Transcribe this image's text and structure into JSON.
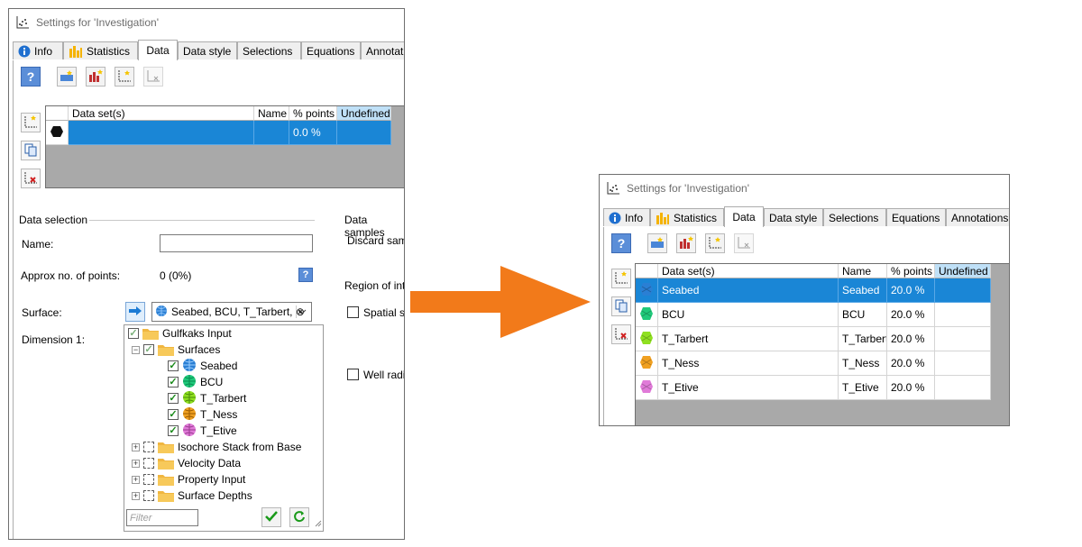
{
  "dialog_title": "Settings for 'Investigation'",
  "tabs_left": [
    "Info",
    "Statistics",
    "Data",
    "Data style",
    "Selections",
    "Equations",
    "Annotatio"
  ],
  "tabs_right": [
    "Info",
    "Statistics",
    "Data",
    "Data style",
    "Selections",
    "Equations",
    "Annotations"
  ],
  "grid_headers": {
    "dataset": "Data set(s)",
    "name": "Name",
    "points": "% points",
    "undefined": "Undefined"
  },
  "left_grid_rows": [
    {
      "dataset": "",
      "name": "",
      "points": "0.0 %",
      "undefined": ""
    }
  ],
  "right_grid_rows": [
    {
      "dataset": "Seabed",
      "name": "Seabed",
      "points": "20.0 %",
      "undefined": "",
      "icon_color": "#2a7fd4"
    },
    {
      "dataset": "BCU",
      "name": "BCU",
      "points": "20.0 %",
      "undefined": "",
      "icon_color": "#1fc97a"
    },
    {
      "dataset": "T_Tarbert",
      "name": "T_Tarbert",
      "points": "20.0 %",
      "undefined": "",
      "icon_color": "#8fe020"
    },
    {
      "dataset": "T_Ness",
      "name": "T_Ness",
      "points": "20.0 %",
      "undefined": "",
      "icon_color": "#f0a020"
    },
    {
      "dataset": "T_Etive",
      "name": "T_Etive",
      "points": "20.0 %",
      "undefined": "",
      "icon_color": "#e07ad8"
    }
  ],
  "data_selection": {
    "section_label": "Data selection",
    "name_label": "Name:",
    "approx_label": "Approx no. of points:",
    "approx_value": "0 (0%)",
    "surface_label": "Surface:",
    "surface_value": "Seabed, BCU, T_Tarbert, ⊗",
    "dimension_label": "Dimension 1:"
  },
  "data_samples": {
    "section_label": "Data samples",
    "discard_label": "Discard samp",
    "region_label": "Region of inter",
    "spatial_label": "Spatial se",
    "well_label": "Well radiu"
  },
  "tree": {
    "root": "Gulfkaks Input",
    "surfaces_folder": "Surfaces",
    "surfaces": [
      {
        "label": "Seabed",
        "color": "#2a7fd4"
      },
      {
        "label": "BCU",
        "color": "#1fc97a"
      },
      {
        "label": "T_Tarbert",
        "color": "#8fe020"
      },
      {
        "label": "T_Ness",
        "color": "#f0a020"
      },
      {
        "label": "T_Etive",
        "color": "#e07ad8"
      }
    ],
    "other_folders": [
      "Isochore Stack from Base",
      "Velocity Data",
      "Property Input",
      "Surface Depths"
    ],
    "filter_placeholder": "Filter"
  },
  "colors": {
    "selected_row": "#1a86d6",
    "arrow": "#f27a1a",
    "undefined_header": "#bfe0f7"
  }
}
